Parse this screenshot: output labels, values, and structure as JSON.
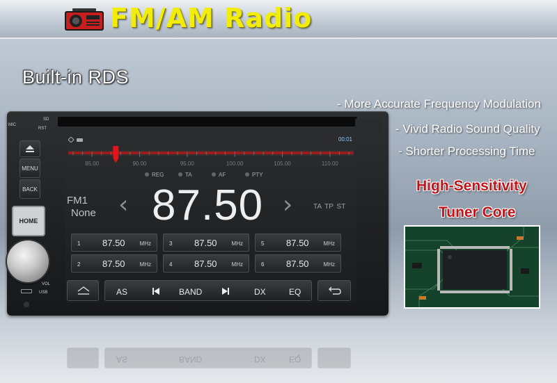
{
  "header": {
    "title": "FM/AM Radio"
  },
  "rds_label": "Built-in RDS",
  "features": [
    "- More Accurate Frequency Modulation",
    "- Vivid Radio Sound Quality",
    "- Shorter Processing Time"
  ],
  "highlight": {
    "line1": "High-Sensitivity",
    "line2": "Tuner Core"
  },
  "device": {
    "labels": {
      "sd": "SD",
      "mic": "MIC",
      "rst": "RST",
      "vol": "VOL",
      "usb": "USB"
    },
    "side_buttons": {
      "menu": "MENU",
      "back": "BACK",
      "home": "HOME"
    },
    "screen": {
      "clock": "00:01",
      "scale": [
        "85.00",
        "90.00",
        "95.00",
        "100.00",
        "105.00",
        "110.00"
      ],
      "tuner_position_mhz": 87.5,
      "scale_range_mhz": [
        82.5,
        112.5
      ],
      "options": [
        "REG",
        "TA",
        "AF",
        "PTY"
      ],
      "band": "FM1",
      "station_name": "None",
      "frequency": "87.50",
      "rds_flags": "TA TP ST",
      "presets": [
        {
          "num": "1",
          "freq": "87.50",
          "unit": "MHz"
        },
        {
          "num": "2",
          "freq": "87.50",
          "unit": "MHz"
        },
        {
          "num": "3",
          "freq": "87.50",
          "unit": "MHz"
        },
        {
          "num": "4",
          "freq": "87.50",
          "unit": "MHz"
        },
        {
          "num": "5",
          "freq": "87.50",
          "unit": "MHz"
        },
        {
          "num": "6",
          "freq": "87.50",
          "unit": "MHz"
        }
      ],
      "toolbar": {
        "as": "AS",
        "band": "BAND",
        "dx": "DX",
        "eq": "EQ"
      }
    }
  },
  "colors": {
    "title_yellow": "#f2ec0a",
    "highlight_red": "#c0141a",
    "clock_blue": "#8fc6ff",
    "tuner_red": "#e0151b"
  }
}
